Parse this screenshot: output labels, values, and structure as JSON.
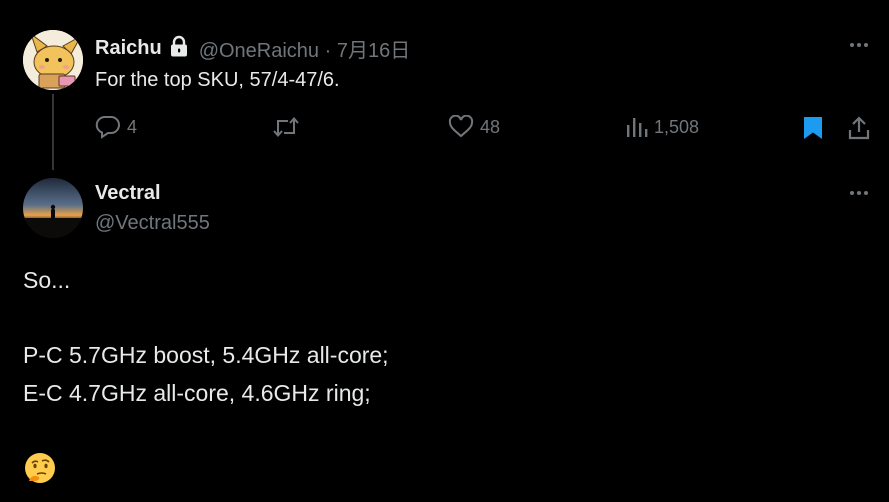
{
  "parent_tweet": {
    "author_name": "Raichu",
    "handle_and_date": "@OneRaichu · 7月16日",
    "text": "For the top SKU, 57/4-47/6.",
    "actions": {
      "replies": "4",
      "retweets": "",
      "likes": "48",
      "views": "1,508"
    },
    "bookmark_color": "#1d9bf0"
  },
  "reply_tweet": {
    "author_name": "Vectral",
    "handle": "@Vectral555",
    "lines": [
      "So...",
      "P-C 5.7GHz boost, 5.4GHz all-core;",
      "E-C 4.7GHz all-core, 4.6GHz ring;"
    ],
    "emoji": "🤔"
  },
  "icons": {
    "lock": "lock-icon",
    "reply": "reply-icon",
    "retweet": "retweet-icon",
    "like": "heart-icon",
    "views": "bar-chart-icon",
    "bookmark": "bookmark-icon",
    "share": "share-icon",
    "more": "more-icon"
  },
  "colors": {
    "background": "#000000",
    "primary_text": "#e7e9ea",
    "secondary_text": "#71767b",
    "accent": "#1d9bf0"
  }
}
